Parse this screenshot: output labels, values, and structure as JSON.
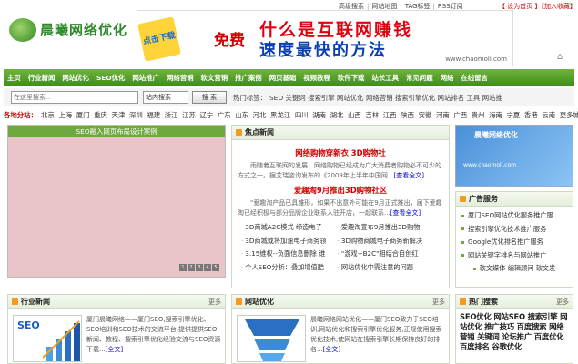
{
  "top": {
    "links": [
      "高级搜索",
      "网站地图",
      "TAG标签",
      "RSS订阅"
    ],
    "favorite": "【 设为首页 】",
    "bookmark": "【加入收藏】"
  },
  "logo": {
    "name": "晨曦网络优化"
  },
  "banner": {
    "button": "点击下载",
    "free": "免费",
    "line1": "什么是互联网赚钱",
    "line2": "速度最快的方法",
    "url": "www.chaomoli.com"
  },
  "nav": {
    "items": [
      "主页",
      "行业新闻",
      "网站优化",
      "SEO优化",
      "网站推广",
      "网络营销",
      "软文营销",
      "推广案例",
      "网页基础",
      "视频教程",
      "软件下载",
      "站长工具",
      "常见问题",
      "网络",
      "在线留言"
    ]
  },
  "search": {
    "placeholder": "在这里搜索...",
    "select": "站内搜索",
    "button": "搜 索",
    "hot_label": "热门标签：",
    "hot_tags": [
      "SEO",
      "关键词",
      "搜索引擎",
      "网站优化",
      "网络营销",
      "搜索引擎优化",
      "网站排名",
      "工具",
      "网站推"
    ]
  },
  "cities": {
    "label": "各地分站：",
    "items": [
      "北京",
      "上海",
      "厦门",
      "重庆",
      "天津",
      "深圳",
      "福建",
      "浙江",
      "江苏",
      "辽宁",
      "广东",
      "山东",
      "河北",
      "黑龙江",
      "四川",
      "湖南",
      "湖北",
      "山西",
      "吉林",
      "江西",
      "陕西",
      "安徽",
      "河南",
      "广西",
      "贵州",
      "海南",
      "宁夏",
      "香港",
      "云南",
      "更多城市"
    ]
  },
  "slide": {
    "caption": "SEO融入网页布局设计案例",
    "pages": [
      "1",
      "2",
      "3",
      "4",
      "5"
    ]
  },
  "focus": {
    "title": "焦点新闻",
    "headline1": "网络购物穿新衣 3D购物社",
    "text1": "雨随着互联网的发展，网络购物已经成为广大消费者购物必不可少的方式之一。据艾瑞咨询发布的《2009年上半年中国网...",
    "more1": "[查看全文]",
    "headline2": "爱趣淘9月推出3D购物社区",
    "text2": "\"爱趣淘产品已具雏形，如果不出意外可能在9月正式推出，届下爱趣淘已经积极与部分品牌企业联系入驻开店，一起联系...",
    "more2": "[查看全文]",
    "list": [
      "3D商城A2C模式 缔造电子",
      "爱趣淘宣布9月推出3D购物",
      "3D商城或将加速电子商务领",
      "3D购物商城电子商务新解决",
      "3.15维权--负面信息删除 谁",
      "\"游戏+B2C\"相结合自创红",
      "个人SEO分析：叠加增值酷",
      "网站优化中需注意的问题"
    ]
  },
  "adimg": {
    "title": "晨曦网络优化",
    "sub": "www.chaomoli.com"
  },
  "ads": {
    "title": "广告服务",
    "items": [
      "厦门SEO网站优化服务推广服",
      "搜索引擎优化技术推广服务",
      "Google优化排名推广服务",
      "网站关键字排名与网站推广"
    ],
    "last": "软文媒体 编辑顾问 软文发"
  },
  "news": {
    "title": "行业新闻",
    "more": "更多",
    "text": "厦门晨曦网络——厦门SEO,搜索引擎优化、SEO培训和SEO技术的交流平台,提供提供SEO新闻、教程、搜索引擎优化经验交流与SEO资源下载...",
    "link": "[全文]"
  },
  "seo": {
    "title": "网站优化",
    "more": "更多",
    "text": "晨曦网络网站优化——厦门SEO致力于SEO培训,网站优化和搜索引擎优化服务,正规使用搜索优化技术,使网站在搜索引擎长期保持良好的排名...",
    "link": "[全文]"
  },
  "hot": {
    "title": "热门搜索",
    "more": "更多",
    "tags": "SEO优化 网站SEO 搜索引擎 网站优化 推广技巧 百度搜索 网络营销 关键词 论坛推广 百度优化 百度排名 谷歌优化"
  },
  "colors": {
    "nav": "#4f9a26",
    "accent": "#f39a1f",
    "headline": "#d10000"
  }
}
